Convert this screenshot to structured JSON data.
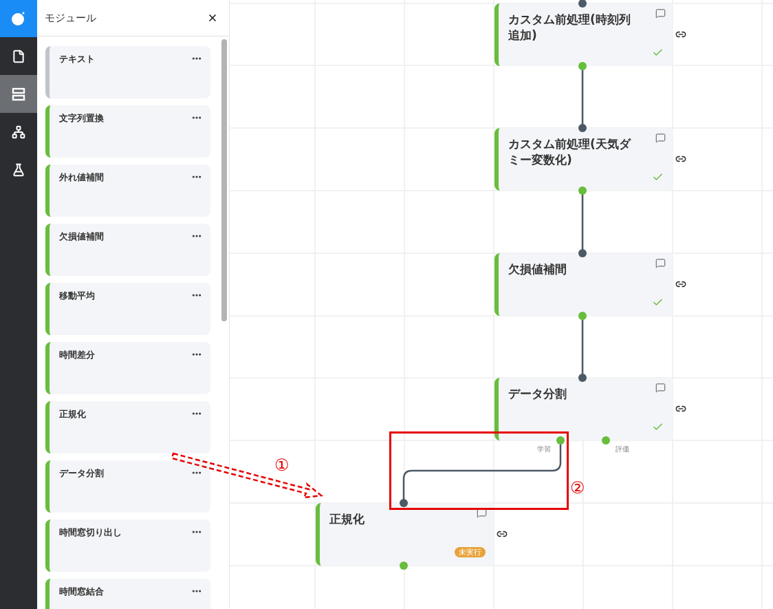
{
  "rail": [
    {
      "kind": "file",
      "selected": false
    },
    {
      "kind": "modules",
      "selected": true
    },
    {
      "kind": "hierarchy",
      "selected": false
    },
    {
      "kind": "flask",
      "selected": false
    }
  ],
  "panel": {
    "title": "モジュール",
    "items": [
      {
        "title": "テキスト",
        "color": "#c0c4cc"
      },
      {
        "title": "文字列置換",
        "color": "#67bd3c"
      },
      {
        "title": "外れ値補間",
        "color": "#67bd3c"
      },
      {
        "title": "欠損値補間",
        "color": "#67bd3c"
      },
      {
        "title": "移動平均",
        "color": "#67bd3c"
      },
      {
        "title": "時間差分",
        "color": "#67bd3c"
      },
      {
        "title": "正規化",
        "color": "#67bd3c"
      },
      {
        "title": "データ分割",
        "color": "#67bd3c"
      },
      {
        "title": "時間窓切り出し",
        "color": "#67bd3c"
      },
      {
        "title": "時間窓結合",
        "color": "#67bd3c"
      }
    ]
  },
  "nodes": [
    {
      "title": "カスタム前処理(時刻列追加)",
      "kind": "done"
    },
    {
      "title": "カスタム前処理(天気ダミー変数化)",
      "kind": "done"
    },
    {
      "title": "欠損値補間",
      "kind": "done"
    },
    {
      "title": "データ分割",
      "kind": "done",
      "outputs": [
        {
          "label": "学習"
        },
        {
          "label": "評価"
        }
      ]
    },
    {
      "title": "正規化",
      "kind": "pending",
      "badge": "未実行"
    }
  ],
  "annotations": {
    "drag_label": "①",
    "connect_label": "②"
  }
}
